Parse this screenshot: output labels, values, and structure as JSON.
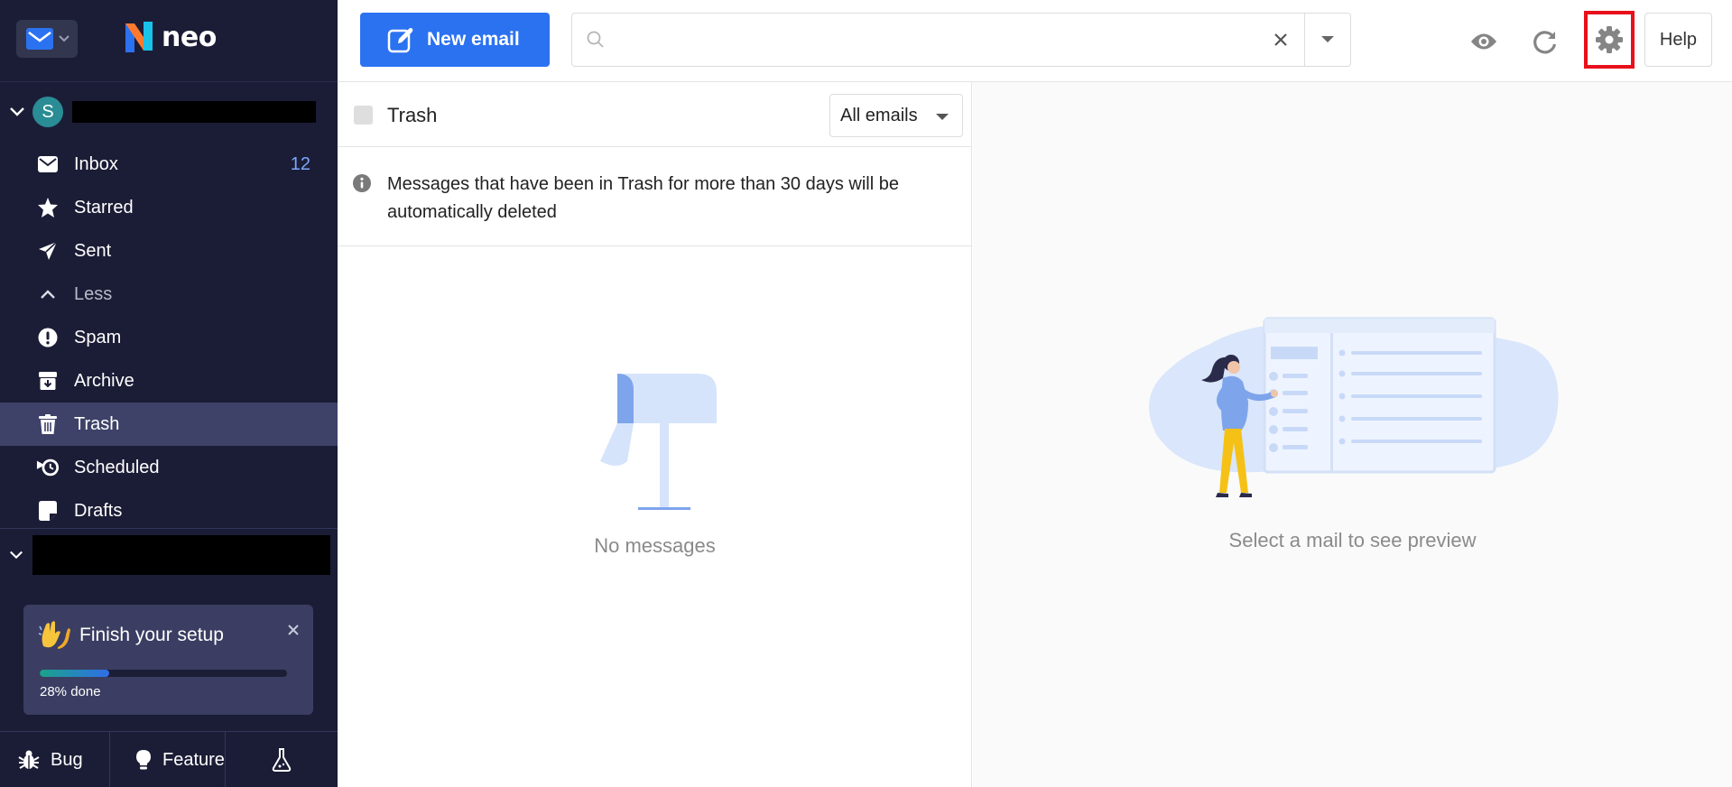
{
  "app": {
    "logo_text": "neo",
    "accent_color": "#2b72f0",
    "sidebar_color": "#1b1d36"
  },
  "sidebar": {
    "account_initial": "S",
    "folders": [
      {
        "label": "Inbox",
        "icon": "envelope-icon",
        "count": "12"
      },
      {
        "label": "Starred",
        "icon": "star-icon"
      },
      {
        "label": "Sent",
        "icon": "paper-plane-icon"
      },
      {
        "label": "Less",
        "icon": "chevron-up-icon"
      },
      {
        "label": "Spam",
        "icon": "exclamation-icon"
      },
      {
        "label": "Archive",
        "icon": "archive-box-icon"
      },
      {
        "label": "Trash",
        "icon": "trash-icon",
        "active": true
      },
      {
        "label": "Scheduled",
        "icon": "scheduled-clock-icon"
      },
      {
        "label": "Drafts",
        "icon": "draft-icon"
      }
    ],
    "setup": {
      "title": "Finish your setup",
      "progress_text": "28% done",
      "progress_fraction": 0.28
    },
    "footer": {
      "bug_label": "Bug",
      "feature_label": "Feature"
    }
  },
  "toolbar": {
    "new_email_label": "New email",
    "search_placeholder": "",
    "help_label": "Help"
  },
  "list": {
    "title": "Trash",
    "filter_label": "All emails",
    "notice": "Messages that have been in Trash for more than 30 days will be automatically deleted",
    "empty_text": "No messages"
  },
  "preview": {
    "empty_text": "Select a mail to see preview"
  }
}
